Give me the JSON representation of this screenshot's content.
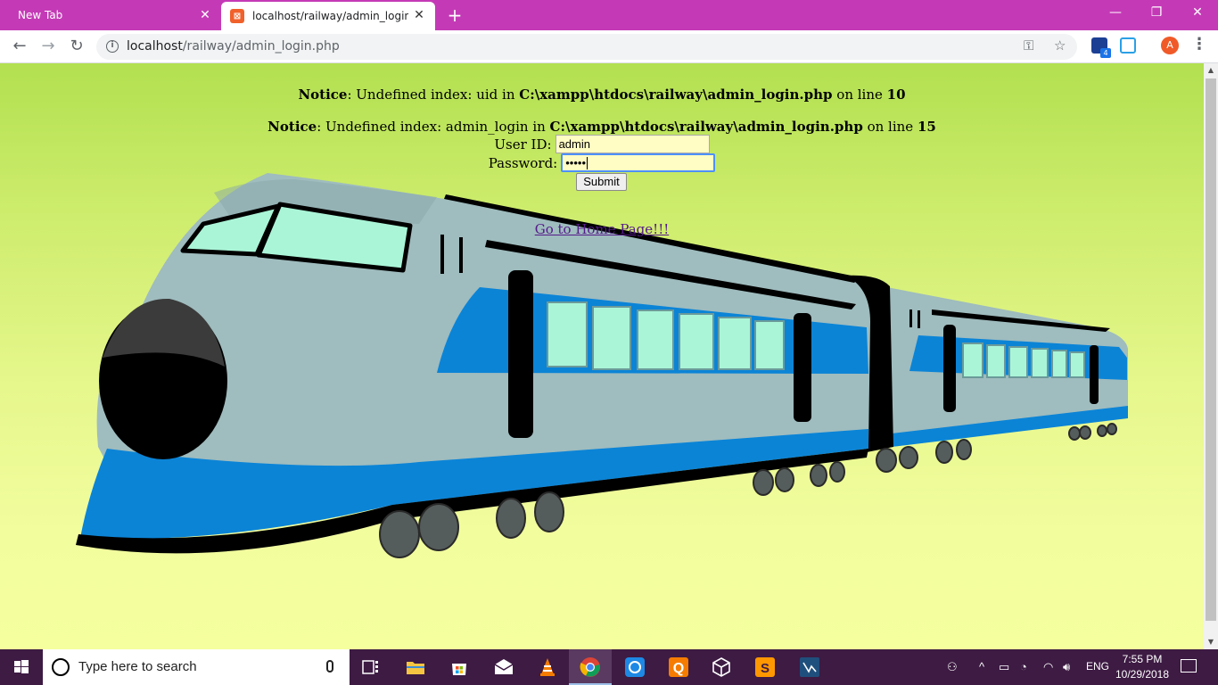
{
  "browser": {
    "tabs": [
      {
        "label": "New Tab"
      },
      {
        "label": "localhost/railway/admin_login.php"
      }
    ],
    "url_host": "localhost",
    "url_path": "/railway/admin_login.php",
    "extension_badge": "4",
    "profile_initial": "A"
  },
  "page": {
    "notice1": {
      "label": "Notice",
      "text1": ": Undefined index: uid in ",
      "path": "C:\\xampp\\htdocs\\railway\\admin_login.php",
      "text2": " on line ",
      "line": "10"
    },
    "notice2": {
      "label": "Notice",
      "text1": ": Undefined index: admin_login in ",
      "path": "C:\\xampp\\htdocs\\railway\\admin_login.php",
      "text2": " on line ",
      "line": "15"
    },
    "user_label": "User ID:",
    "user_value": "admin",
    "password_label": "Password:",
    "password_masked": "•••••",
    "submit_label": "Submit",
    "home_link": "Go to Home Page!!!"
  },
  "taskbar": {
    "search_placeholder": "Type here to search",
    "language": "ENG",
    "time": "7:55 PM",
    "date": "10/29/2018"
  },
  "colors": {
    "tabbar": "#c43ab6",
    "taskbar": "#3d1b43",
    "train_body": "#9fbcbe",
    "train_stripe": "#0b84d6",
    "window_glass": "#aaf5d8"
  }
}
